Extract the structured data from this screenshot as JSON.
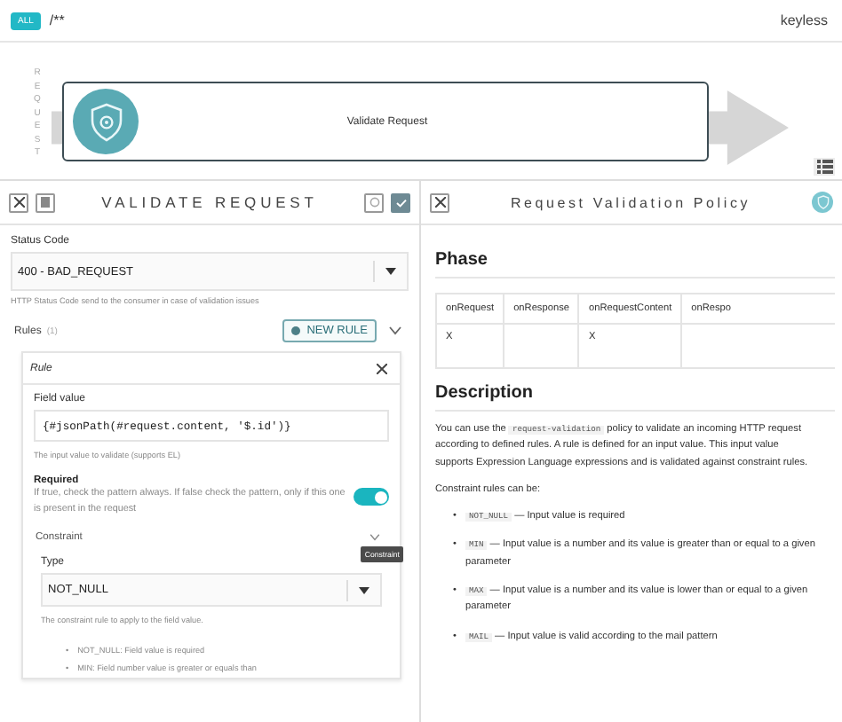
{
  "top_bar": {
    "method": "ALL",
    "path": "/**",
    "plan": "keyless"
  },
  "flow": {
    "side_label": "REQUEST",
    "step": {
      "title": "Validate Request"
    }
  },
  "left_panel": {
    "title": "VALIDATE REQUEST",
    "status_code": {
      "label": "Status Code",
      "value": "400 - BAD_REQUEST",
      "help": "HTTP Status Code send to the consumer in case of validation issues"
    },
    "rules": {
      "label": "Rules",
      "count": "(1)",
      "new_button": "NEW RULE",
      "rule": {
        "title": "Rule",
        "field_value": {
          "label": "Field value",
          "value": "{#jsonPath(#request.content, '$.id')}",
          "help": "The input value to validate (supports EL)"
        },
        "required": {
          "label": "Required",
          "description": "If true, check the pattern always. If false check the pattern, only if this one is present in the request",
          "on": true
        },
        "constraint": {
          "label": "Constraint",
          "tooltip": "Constraint",
          "type": {
            "label": "Type",
            "value": "NOT_NULL",
            "help": "The constraint rule to apply to the field value."
          },
          "options": [
            {
              "marker": "•",
              "text": "NOT_NULL: Field value is required"
            },
            {
              "marker": "•",
              "text": "MIN: Field number value is greater or equals than"
            }
          ]
        }
      }
    }
  },
  "right_panel": {
    "title": "Request Validation Policy",
    "phase": {
      "heading": "Phase",
      "columns": [
        {
          "name": "onRequest",
          "mark": "X"
        },
        {
          "name": "onResponse"
        },
        {
          "name": "onRequestContent",
          "mark": "X"
        },
        {
          "name": "onRespo"
        }
      ]
    },
    "description": {
      "heading": "Description",
      "intro": [
        {
          "kind": "text",
          "text": "You can use the "
        },
        {
          "kind": "code",
          "text": "request-validation"
        },
        {
          "kind": "text",
          "text": " policy to validate an incoming HTTP request according to defined rules. A rule is defined for an input value. This input value supports Expression Language expressions and is validated against constraint rules."
        }
      ],
      "lead": "Constraint rules can be:",
      "rules": [
        {
          "marker": "•",
          "code": "NOT_NULL",
          "text": "— Input value is required"
        },
        {
          "marker": "•",
          "code": "MIN",
          "text": "— Input value is a number and its value is greater than or equal to a given parameter"
        },
        {
          "marker": "•",
          "code": "MAX",
          "text": "— Input value is a number and its value is lower than or equal to a given parameter"
        },
        {
          "marker": "•",
          "code": "MAIL",
          "text": "— Input value is valid according to the mail pattern"
        }
      ]
    }
  }
}
